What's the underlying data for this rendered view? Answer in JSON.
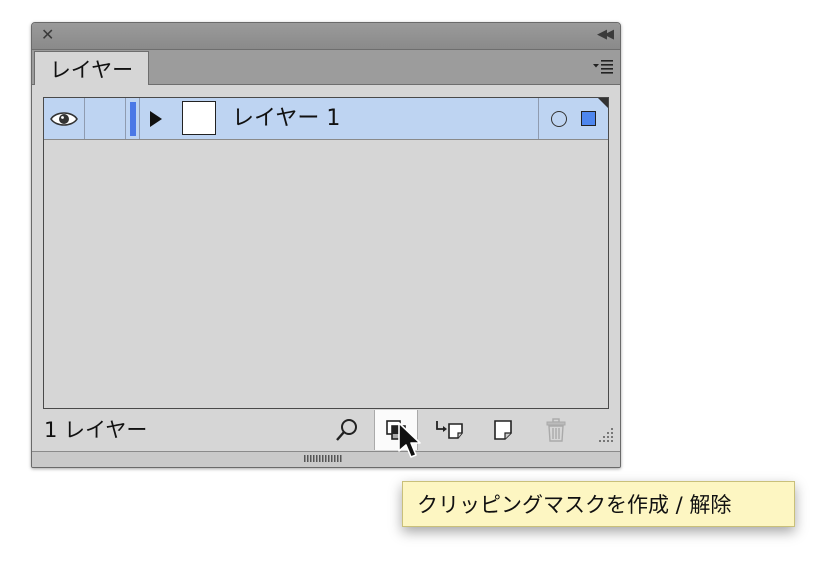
{
  "window": {
    "close_icon": "close-icon",
    "collapse_icon": "double-chevron-left-icon"
  },
  "tabs": [
    {
      "label": "レイヤー",
      "active": true
    }
  ],
  "panel_menu_icon": "panel-menu-icon",
  "layers": [
    {
      "name": "レイヤー 1",
      "visible": true,
      "color": "#4b78e6",
      "expanded": false,
      "selected": true
    }
  ],
  "status": {
    "layer_count_text": "1 レイヤー"
  },
  "toolbar": {
    "buttons": [
      {
        "name": "locate-object-button",
        "icon": "magnifier-icon"
      },
      {
        "name": "clipping-mask-button",
        "icon": "clipping-mask-icon",
        "hovered": true
      },
      {
        "name": "new-sublayer-button",
        "icon": "new-sublayer-icon"
      },
      {
        "name": "new-layer-button",
        "icon": "new-layer-icon"
      },
      {
        "name": "delete-button",
        "icon": "trash-icon",
        "disabled": true
      }
    ]
  },
  "tooltip": {
    "text": "クリッピングマスクを作成 / 解除"
  },
  "colors": {
    "selection": "#bed4f2",
    "layer_color": "#4b78e6",
    "tooltip_bg": "#fdf6c2",
    "panel_bg": "#d6d6d6"
  }
}
